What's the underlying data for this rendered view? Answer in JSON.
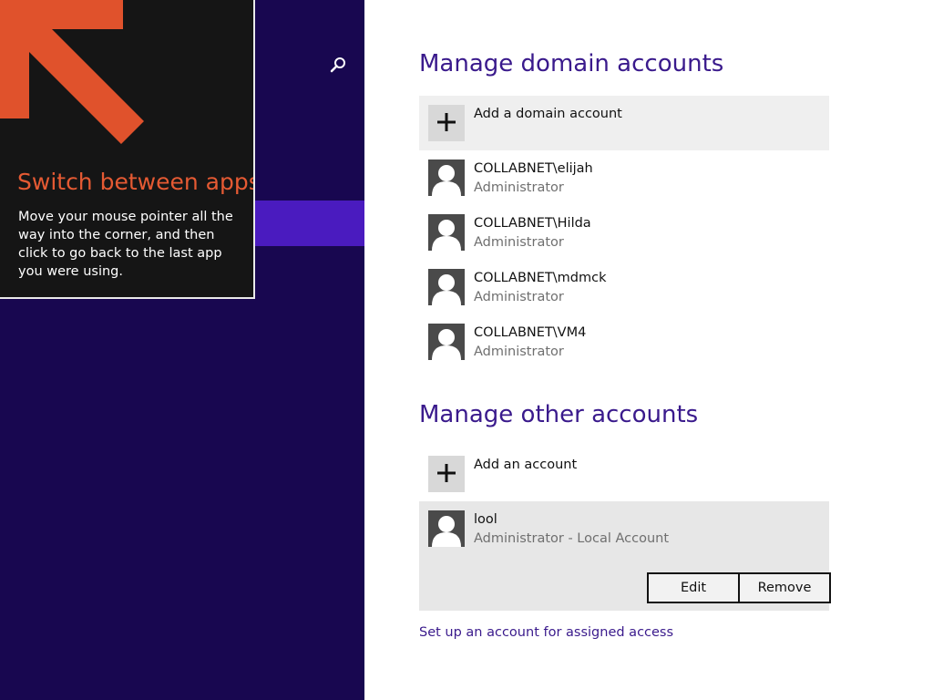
{
  "tip": {
    "title": "Switch between apps",
    "body": "Move your mouse pointer all the way into the corner, and then click to go back to the last app you were using."
  },
  "sidebar": {
    "search_icon": "search-icon"
  },
  "domain_section": {
    "title": "Manage domain accounts",
    "add_label": "Add a domain account",
    "accounts": [
      {
        "name": "COLLABNET\\elijah",
        "role": "Administrator"
      },
      {
        "name": "COLLABNET\\Hilda",
        "role": "Administrator"
      },
      {
        "name": "COLLABNET\\mdmck",
        "role": "Administrator"
      },
      {
        "name": "COLLABNET\\VM4",
        "role": "Administrator"
      }
    ]
  },
  "other_section": {
    "title": "Manage other accounts",
    "add_label": "Add an account",
    "selected_account": {
      "name": "lool",
      "role": "Administrator - Local Account"
    },
    "edit_label": "Edit",
    "remove_label": "Remove"
  },
  "assigned_access_link": "Set up an account for assigned access",
  "colors": {
    "sidebar_bg": "#180750",
    "selected_bar": "#4a1bbf",
    "accent_text": "#3a1a8c",
    "tip_title": "#e55a33",
    "tip_arrow": "#e0522c"
  }
}
